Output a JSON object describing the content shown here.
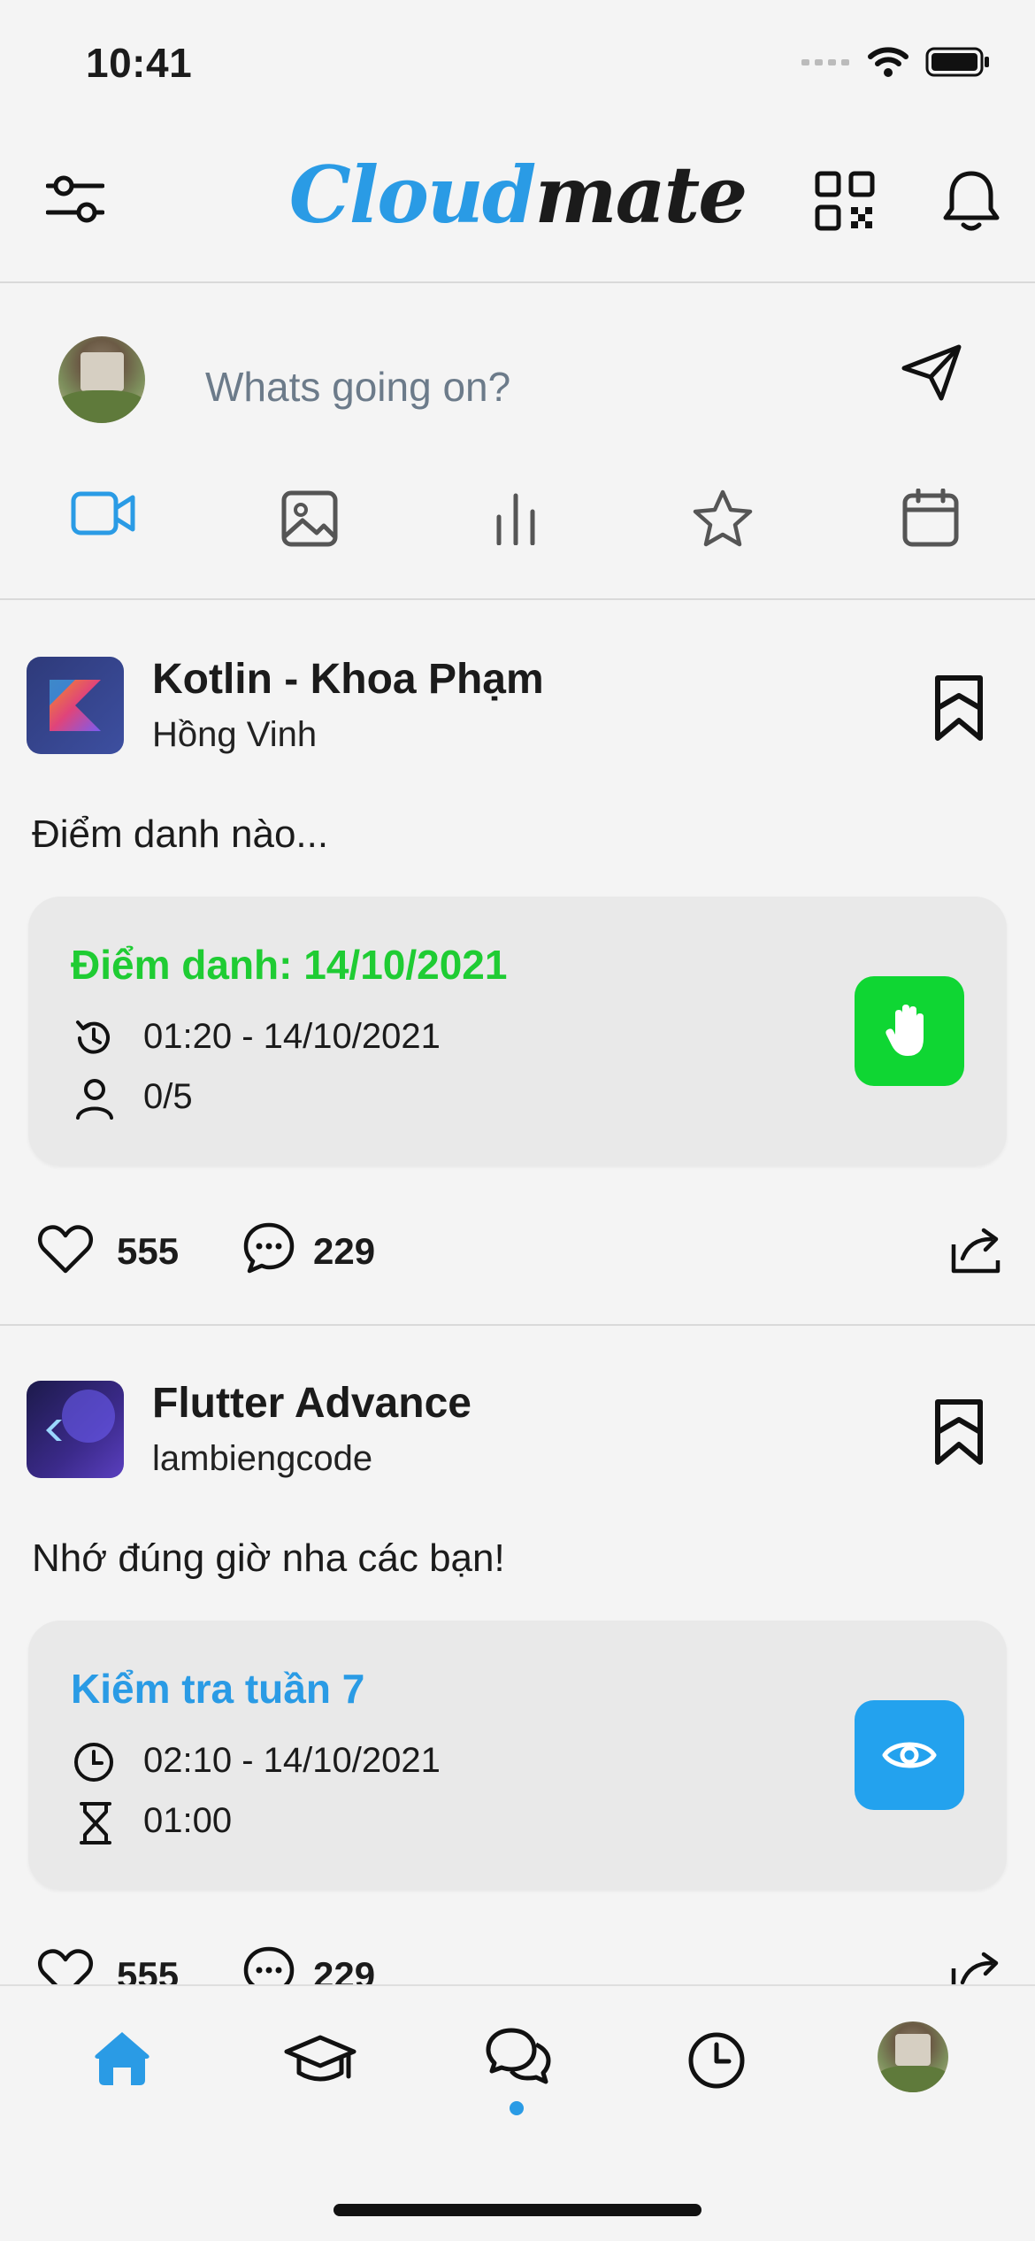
{
  "status_bar": {
    "time": "10:41"
  },
  "header": {
    "app_name_part1": "Cloud",
    "app_name_part2": "mate",
    "icons": [
      "sliders-icon",
      "qr-code-icon",
      "bell-icon"
    ]
  },
  "composer": {
    "placeholder": "Whats going on?",
    "actions": [
      "video-icon",
      "image-icon",
      "chart-icon",
      "star-icon",
      "calendar-icon"
    ]
  },
  "posts": [
    {
      "title": "Kotlin - Khoa Phạm",
      "author": "Hồng Vinh",
      "text": "Điểm danh nào...",
      "card": {
        "title": "Điểm danh: 14/10/2021",
        "time": "01:20 - 14/10/2021",
        "secondary": "0/5",
        "title_color": "#1fcc33",
        "action_color": "#0fd633"
      },
      "likes": "555",
      "comments": "229"
    },
    {
      "title": "Flutter Advance",
      "author": "lambiengcode",
      "text": "Nhớ đúng giờ nha các bạn!",
      "card": {
        "title": "Kiểm tra tuần 7",
        "time": "02:10 - 14/10/2021",
        "secondary": "01:00",
        "title_color": "#2a9be5",
        "action_color": "#23a2ee"
      },
      "likes": "555",
      "comments": "229"
    }
  ],
  "tab_bar": {
    "items": [
      "home-icon",
      "graduation-cap-icon",
      "chat-icon",
      "clock-icon",
      "profile-avatar"
    ],
    "active_index": 0,
    "accent": "#2a9be5"
  }
}
